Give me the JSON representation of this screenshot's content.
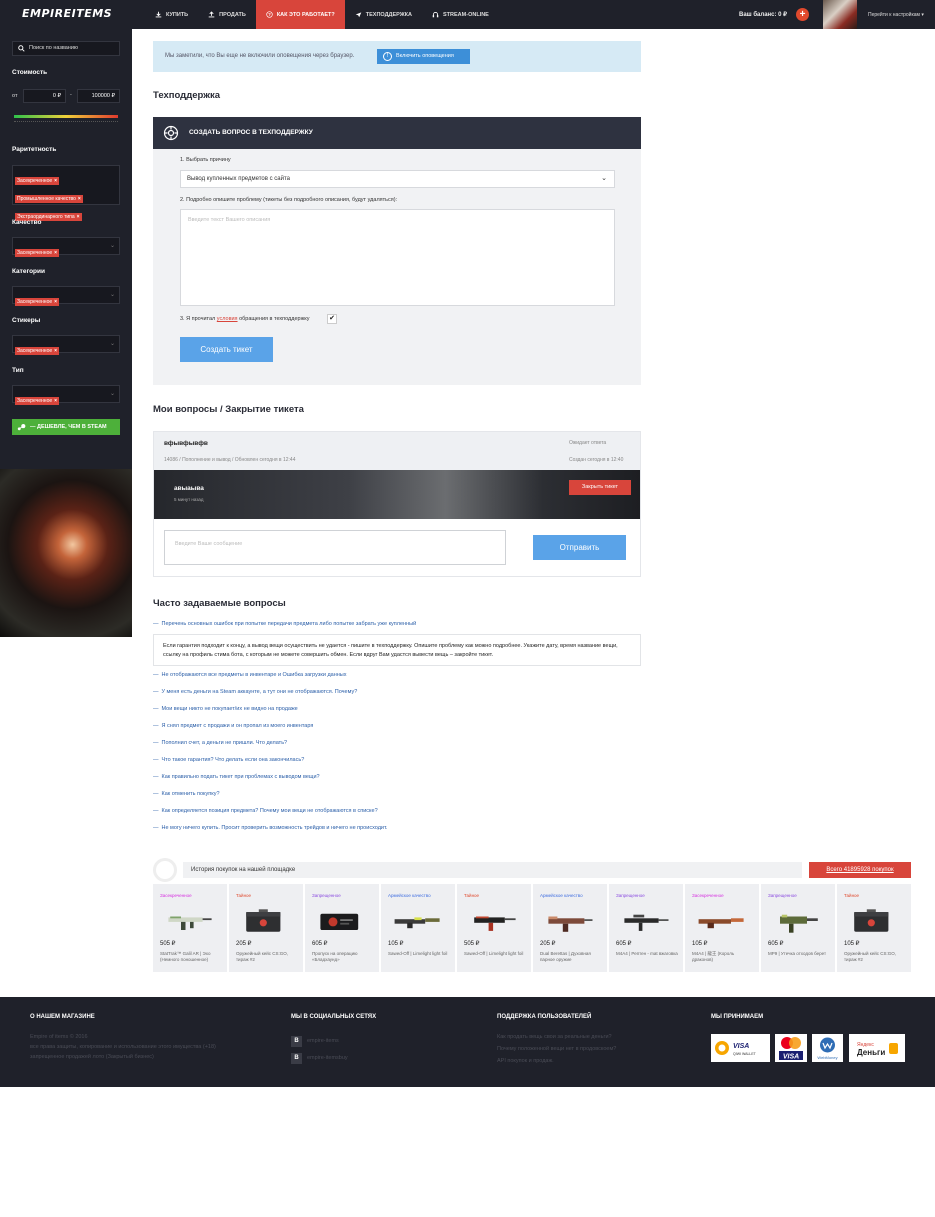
{
  "header": {
    "logo": "EMPIREITEMS",
    "nav": [
      {
        "label": "Купить",
        "icon": "download-icon"
      },
      {
        "label": "Продать",
        "icon": "upload-icon"
      },
      {
        "label": "Как это работает?",
        "icon": "help-icon",
        "active": true
      },
      {
        "label": "Техподдержка",
        "icon": "plane-icon"
      },
      {
        "label": "Stream-online",
        "icon": "headset-icon"
      }
    ],
    "balance_label": "Ваш баланс: 0 ₽",
    "settings": "Перейти к настройкам"
  },
  "sidebar": {
    "search_placeholder": "Поиск по названию",
    "cost_label": "Стоимость",
    "from": "от",
    "min": "0 ₽",
    "dash": "-",
    "max": "100000 ₽",
    "rarity_label": "Раритетность",
    "rarity_tags": [
      "Засекреченное",
      "Промышленное качество",
      "Экстраординарного типа"
    ],
    "quality_label": "Качество",
    "quality_tag": "Засекреченное",
    "category_label": "Категории",
    "category_tag": "Засекреченное",
    "stickers_label": "Стикеры",
    "stickers_tag": "Засекреченное",
    "type_label": "Тип",
    "type_tag": "Засекреченное",
    "steam_button": "— дешевле, чем в Steam"
  },
  "notification": {
    "text": "Мы заметили, что Вы еще не включили оповещения через браузер.",
    "button": "Включить оповещения"
  },
  "support": {
    "title": "Техподдержка",
    "panel_title": "Создать вопрос в техподдержку",
    "step1": "1. Выбрать причину",
    "reason": "Вывод купленных предметов с сайта",
    "step2": "2. Подробно опишите проблему (тикеты без подробного описания, будут удаляться):",
    "description_placeholder": "Введите текст Вашего описания",
    "agree_prefix": "3. Я прочитал",
    "agree_link": "условия",
    "agree_suffix": "обращения в техподдержку",
    "create_button": "Создать тикет"
  },
  "tickets": {
    "title": "Мои вопросы / Закрытие тикета",
    "ticket_title": "вфывфывфв",
    "ticket_meta": "14086 / Пополнение и вывод / Обновлен сегодня в 12:44",
    "status": "Ожидает ответа",
    "created": "Создан сегодня в 12:40",
    "message_author": "авыаыва",
    "message_time": "5 минут назад",
    "close_button": "Закрыть тикет",
    "message_placeholder": "Введите Ваше сообщение",
    "send_button": "Отправить"
  },
  "faq": {
    "title": "Часто задаваемые вопросы",
    "first_question": "Перечень основных ошибок при попытке передачи предмета либо попытке забрать уже купленный",
    "answer": "Если гарантия подходит к концу, а вывод вещи осуществить не удается - пишите в техподдержку. Опишите проблему как можно подробнее. Укажите дату, время название вещи, ссылку на профиль стима бота, с которым не можете совершить обмен. Если вдруг Вам удастся вывести вещь – закройте тикет.",
    "questions": [
      "Не отображаются все предметы в инвентаре и Ошибка загрузки данных",
      "У меня есть деньги на Steam аккаунте, а тут они не отображаются. Почему?",
      "Мои вещи никто не покупает/их не видно на продаже",
      "Я снял предмет с продажи и он пропал из моего инвентаря",
      "Пополнил счет, а деньги не пришли. Что делать?",
      "Что такое гарантия? Что делать если она закончилась?",
      "Как правильно подать тикет при проблемах с выводом вещи?",
      "Как отменить покупку?",
      "Как определяется позиция предмета? Почему мои вещи не отображаются в списке?",
      "Не могу ничего купить. Просит проверить возможность трейдов и ничего не происходит."
    ]
  },
  "history": {
    "label": "История покупок на нашей площадке",
    "count": "Всего 41895928 покупок",
    "items": [
      {
        "quality": "Засекреченное",
        "color": "#d62ee0",
        "price": "505 ₽",
        "name": "StatTrak™ Galil AR | Эхо (Немного поношенное)",
        "kind": "rifle"
      },
      {
        "quality": "Тайное",
        "color": "#e0492d",
        "price": "205 ₽",
        "name": "Оружейный кейс CS:GO, тираж #2",
        "kind": "case"
      },
      {
        "quality": "Запрещенное",
        "color": "#8b4be0",
        "price": "605 ₽",
        "name": "Пропуск на операцию «Бладхаунд»",
        "kind": "pass"
      },
      {
        "quality": "Армейское качество",
        "color": "#3d6ce0",
        "price": "105 ₽",
        "name": "Sawed-Off | Limelight light foil",
        "kind": "shotgun"
      },
      {
        "quality": "Тайное",
        "color": "#e0492d",
        "price": "505 ₽",
        "name": "Sawed-Off | Limelight light foil",
        "kind": "rifle2"
      },
      {
        "quality": "Армейское качество",
        "color": "#3d6ce0",
        "price": "205 ₽",
        "name": "Dual Berettas | Духовная парное оружие",
        "kind": "rifle3"
      },
      {
        "quality": "Запрещенное",
        "color": "#8b4be0",
        "price": "605 ₽",
        "name": "M4A4 | Рептен - mat вжаговка",
        "kind": "m4"
      },
      {
        "quality": "Засекреченное",
        "color": "#d62ee0",
        "price": "105 ₽",
        "name": "M4A4 | 龍王 (Король драконов)",
        "kind": "shotgun2"
      },
      {
        "quality": "Запрещенное",
        "color": "#8b4be0",
        "price": "605 ₽",
        "name": "MP9 | Утечка отходов берет",
        "kind": "smg"
      },
      {
        "quality": "Тайное",
        "color": "#e0492d",
        "price": "105 ₽",
        "name": "Оружейный кейс CS:GO, тираж #2",
        "kind": "case"
      }
    ]
  },
  "footer": {
    "about_title": "О нашем магазине",
    "about_lines": [
      "Empire of items © 2016",
      "все права защиты, копирование и использование этого имущества (+18)",
      "запрещенное продажей лото (Закрытый бизнес)"
    ],
    "social_title": "Мы в социальных сетях",
    "social_links": [
      "empire-items",
      "empire-itemsbuy"
    ],
    "support_title": "Поддержка пользователей",
    "support_links": [
      "Как продать вещь свои за реальные деньги?",
      "Почему положенной вещи нет в продовскоем?",
      "API покупок и продаж."
    ],
    "payments_title": "Мы принимаем",
    "payments": [
      "VISA QIWI WALLET",
      "MasterCard VISA",
      "WebMoney",
      "Яндекс Деньги"
    ]
  }
}
